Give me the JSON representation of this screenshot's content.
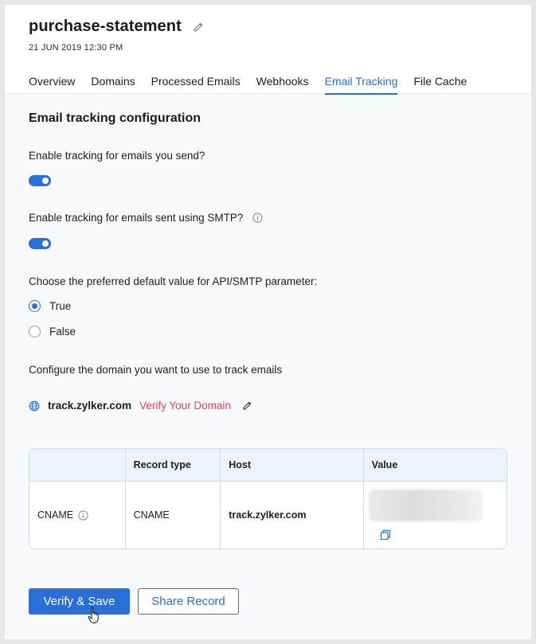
{
  "header": {
    "title": "purchase-statement",
    "date": "21 JUN 2019 12:30 PM"
  },
  "tabs": [
    {
      "label": "Overview",
      "active": false
    },
    {
      "label": "Domains",
      "active": false
    },
    {
      "label": "Processed Emails",
      "active": false
    },
    {
      "label": "Webhooks",
      "active": false
    },
    {
      "label": "Email Tracking",
      "active": true
    },
    {
      "label": "File Cache",
      "active": false
    }
  ],
  "config": {
    "section_title": "Email tracking configuration",
    "tracking_send_label": "Enable tracking for emails you send?",
    "tracking_send_enabled": true,
    "tracking_smtp_label": "Enable tracking for emails sent using SMTP?",
    "tracking_smtp_enabled": true,
    "default_value_label": "Choose the preferred default value for API/SMTP parameter:",
    "options": [
      {
        "label": "True",
        "checked": true
      },
      {
        "label": "False",
        "checked": false
      }
    ],
    "domain_label": "Configure the domain you want to use to track emails",
    "domain": "track.zylker.com",
    "verify_link": "Verify Your Domain"
  },
  "table": {
    "headers": [
      "",
      "Record type",
      "Host",
      "Value"
    ],
    "row": {
      "name": "CNAME",
      "record_type": "CNAME",
      "host": "track.zylker.com"
    }
  },
  "actions": {
    "verify_save": "Verify & Save",
    "share_record": "Share Record"
  },
  "colors": {
    "accent": "#2a6ed8",
    "link_pink": "#d94468"
  }
}
